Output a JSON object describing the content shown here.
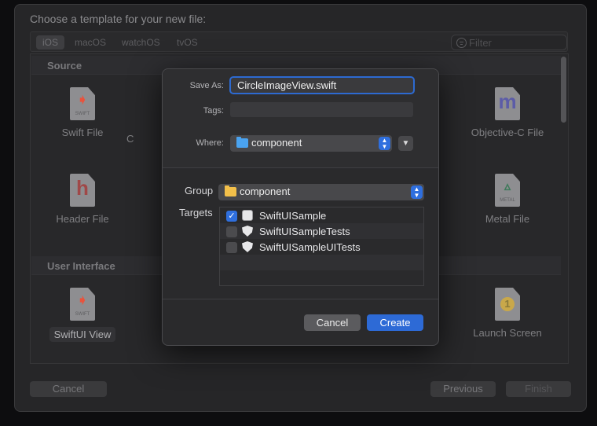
{
  "sheet": {
    "title": "Choose a template for your new file:",
    "platform_tabs": [
      {
        "label": "iOS",
        "active": true
      },
      {
        "label": "macOS",
        "active": false
      },
      {
        "label": "watchOS",
        "active": false
      },
      {
        "label": "tvOS",
        "active": false
      }
    ],
    "filter_placeholder": "Filter",
    "sections": {
      "source": "Source",
      "user_interface": "User Interface"
    },
    "templates": {
      "swift_file": {
        "label": "Swift File",
        "icon": "swift-file-icon",
        "glyph": "SWIFT"
      },
      "partial_c": {
        "label": "C"
      },
      "objc_file": {
        "label": "Objective-C File",
        "icon": "objective-c-file-icon",
        "glyph": "m"
      },
      "header_file": {
        "label": "Header File",
        "icon": "header-file-icon",
        "glyph": "h"
      },
      "metal_file": {
        "label": "Metal File",
        "icon": "metal-file-icon",
        "glyph": "METAL"
      },
      "swiftui_view": {
        "label": "SwiftUI View",
        "icon": "swiftui-view-icon",
        "glyph": "SWIFT"
      },
      "launch_screen": {
        "label": "Launch Screen",
        "icon": "launch-screen-icon",
        "glyph": "1"
      }
    },
    "footer": {
      "cancel": "Cancel",
      "previous": "Previous",
      "finish": "Finish"
    }
  },
  "dialog": {
    "save_as_label": "Save As:",
    "save_as_value": "CircleImageView.swift",
    "tags_label": "Tags:",
    "tags_value": "",
    "where_label": "Where:",
    "where_value": "component",
    "group_label": "Group",
    "group_value": "component",
    "targets_label": "Targets",
    "targets": [
      {
        "name": "SwiftUISample",
        "checked": true,
        "icon": "app-target-icon"
      },
      {
        "name": "SwiftUISampleTests",
        "checked": false,
        "icon": "test-target-icon"
      },
      {
        "name": "SwiftUISampleUITests",
        "checked": false,
        "icon": "test-target-icon"
      }
    ],
    "cancel_button": "Cancel",
    "create_button": "Create"
  },
  "colors": {
    "accent": "#2d6ad6",
    "folder": "#4aa3f0",
    "folder_yellow": "#f3c04a",
    "swift": "#e8533d"
  }
}
